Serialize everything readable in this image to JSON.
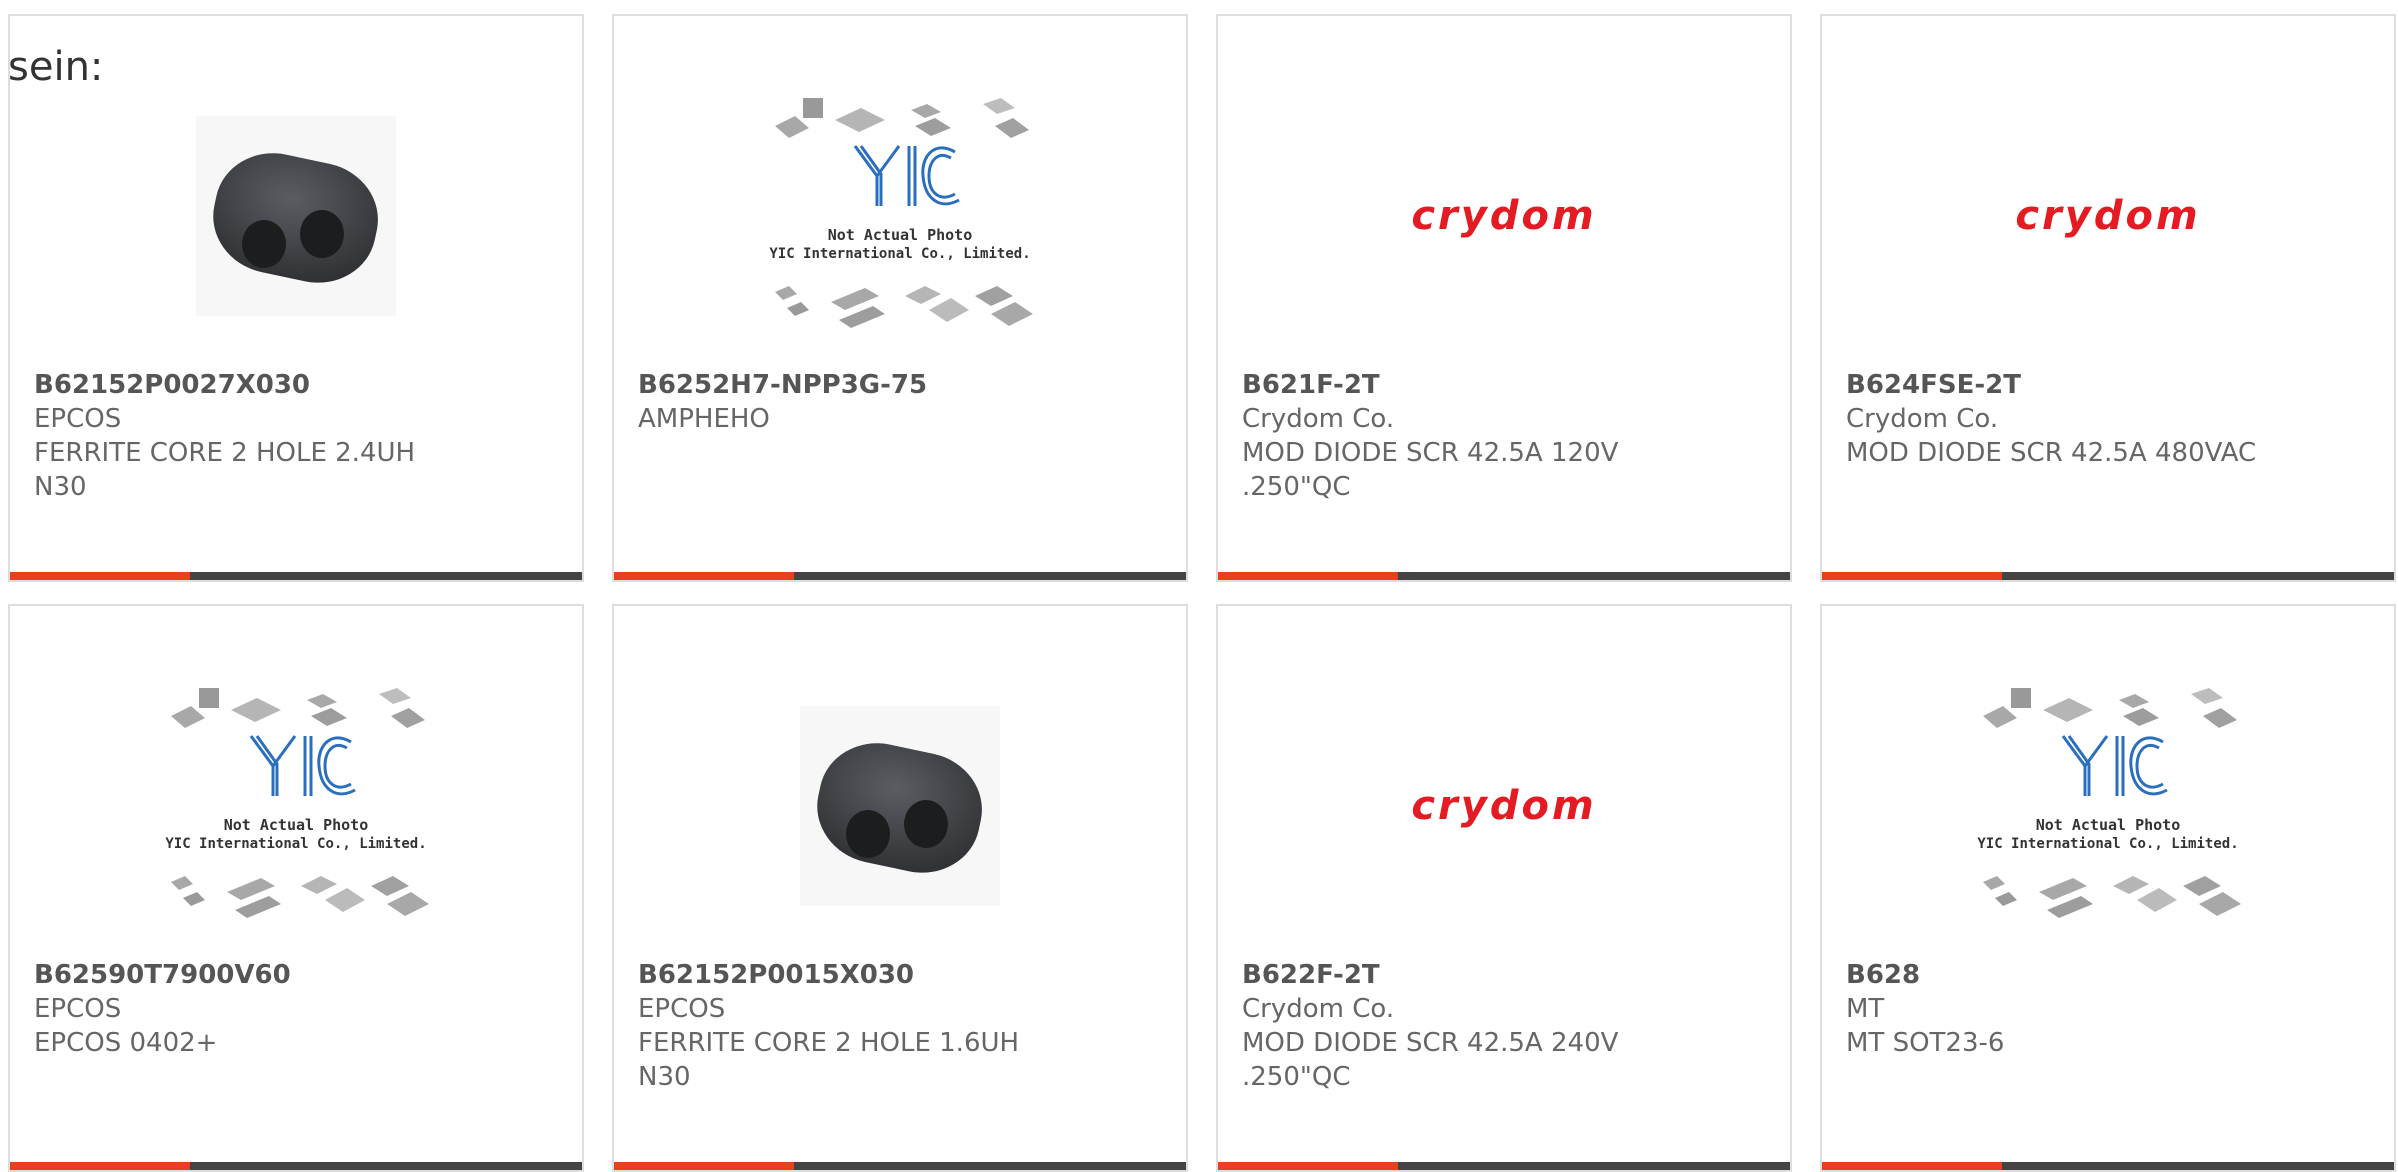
{
  "intro_text": "sein:",
  "colors": {
    "accent": "#e8401c",
    "bar": "#444444",
    "crydom_red": "#e41b23",
    "yic_blue": "#2a6fbf"
  },
  "products": [
    {
      "part": "B62152P0027X030",
      "maker": "EPCOS",
      "desc1": "FERRITE CORE 2 HOLE 2.4UH",
      "desc2": "N30",
      "image": "ferrite-core",
      "image_text": []
    },
    {
      "part": "B6252H7-NPP3G-75",
      "maker": "AMPHEHO",
      "desc1": "",
      "desc2": "",
      "image": "yic-placeholder",
      "image_text": [
        "Not Actual Photo",
        "YIC International Co., Limited."
      ]
    },
    {
      "part": "B621F-2T",
      "maker": "Crydom Co.",
      "desc1": "MOD DIODE SCR 42.5A 120V",
      "desc2": ".250\"QC",
      "image": "crydom-logo",
      "image_text": [
        "crydom"
      ]
    },
    {
      "part": "B624FSE-2T",
      "maker": "Crydom Co.",
      "desc1": "MOD DIODE SCR 42.5A 480VAC",
      "desc2": "",
      "image": "crydom-logo",
      "image_text": [
        "crydom"
      ]
    },
    {
      "part": "B62590T7900V60",
      "maker": "EPCOS",
      "desc1": "EPCOS 0402+",
      "desc2": "",
      "image": "yic-placeholder",
      "image_text": [
        "Not Actual Photo",
        "YIC International Co., Limited."
      ]
    },
    {
      "part": "B62152P0015X030",
      "maker": "EPCOS",
      "desc1": "FERRITE CORE 2 HOLE 1.6UH",
      "desc2": "N30",
      "image": "ferrite-core",
      "image_text": []
    },
    {
      "part": "B622F-2T",
      "maker": "Crydom Co.",
      "desc1": "MOD DIODE SCR 42.5A 240V",
      "desc2": ".250\"QC",
      "image": "crydom-logo",
      "image_text": [
        "crydom"
      ]
    },
    {
      "part": "B628",
      "maker": "MT",
      "desc1": "MT SOT23-6",
      "desc2": "",
      "image": "yic-placeholder",
      "image_text": [
        "Not Actual Photo",
        "YIC International Co., Limited."
      ]
    }
  ]
}
